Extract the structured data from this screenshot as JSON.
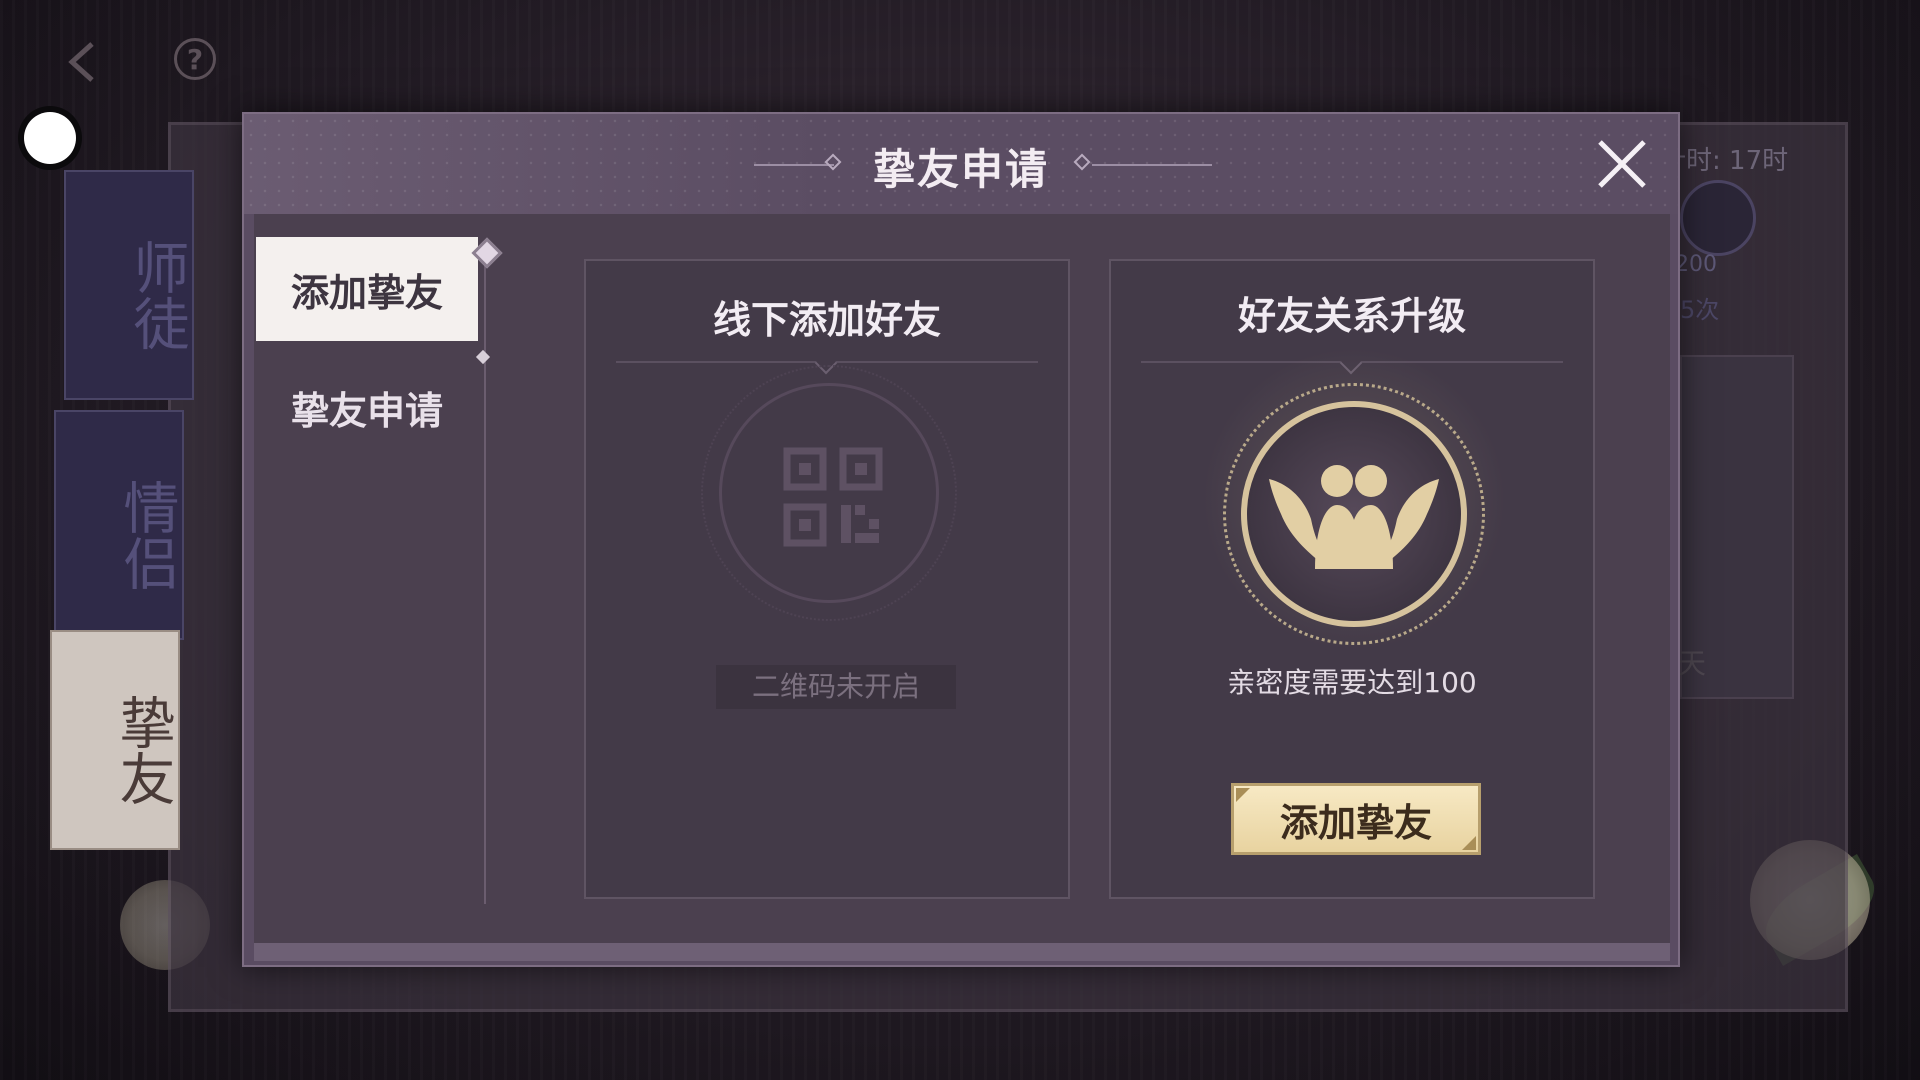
{
  "modal": {
    "title": "挚友申请"
  },
  "tabs": [
    {
      "label": "添加挚友",
      "active": true
    },
    {
      "label": "挚友申请",
      "active": false
    }
  ],
  "cards": {
    "offline": {
      "title": "线下添加好友",
      "note": "二维码未开启"
    },
    "upgrade": {
      "title": "好友关系升级",
      "requirement": "亲密度需要达到100",
      "button": "添加挚友"
    }
  },
  "background": {
    "side_tabs": [
      "师徒",
      "情侣",
      "挚友"
    ],
    "timer_text": "计时: 17时",
    "number_text": "200",
    "times_text": "5次",
    "day_text": "天"
  },
  "colors": {
    "modal_bg": "#4b404f",
    "header_bg": "#5b4d63",
    "button_gold": "#e8d3a0",
    "active_tab_bg": "#f4f0ee"
  },
  "icons": [
    "back-icon",
    "help-icon",
    "close-icon",
    "qr-code-icon",
    "friendship-wings-icon"
  ]
}
